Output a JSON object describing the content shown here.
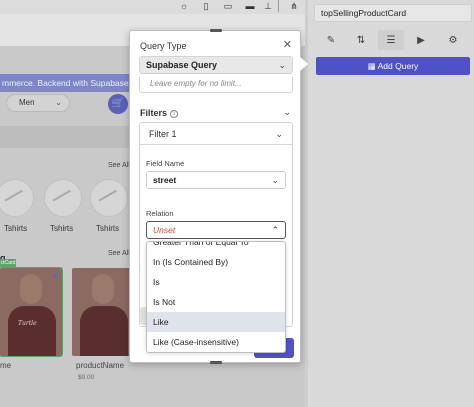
{
  "canvas": {
    "banner_text": "mmerce. Backend with Supabase.",
    "gender_value": "Men",
    "see_all_1": "See All",
    "see_all_2": "See All",
    "categories": [
      "Tshirts",
      "Tshirts",
      "Tshirts"
    ],
    "section_title": "g",
    "card_tag": "ctCard",
    "card_shirt_text": "Turtle",
    "product_name_1": "me",
    "product_name_2": "productName",
    "product_price_2": "$0.00"
  },
  "right_panel": {
    "component_name": "topSellingProductCard",
    "add_query_label": "Add Query",
    "tools": [
      "brush-icon",
      "flow-icon",
      "database-icon",
      "play-icon",
      "gear-icon"
    ]
  },
  "popup": {
    "title": "Query Type",
    "query_type_value": "Supabase Query",
    "limit_placeholder": "Leave empty for no limit...",
    "filters_label": "Filters",
    "filter_1_label": "Filter 1",
    "field_name_label": "Field Name",
    "field_name_value": "street",
    "relation_label": "Relation",
    "relation_value": "Unset"
  },
  "relation_dropdown": {
    "options": [
      {
        "label": "Greater Than or Equal To",
        "highlighted": false
      },
      {
        "label": "In (Is Contained By)",
        "highlighted": false
      },
      {
        "label": "Is",
        "highlighted": false
      },
      {
        "label": "Is Not",
        "highlighted": false
      },
      {
        "label": "Like",
        "highlighted": true
      },
      {
        "label": "Like (Case-insensitive)",
        "highlighted": false
      }
    ]
  }
}
